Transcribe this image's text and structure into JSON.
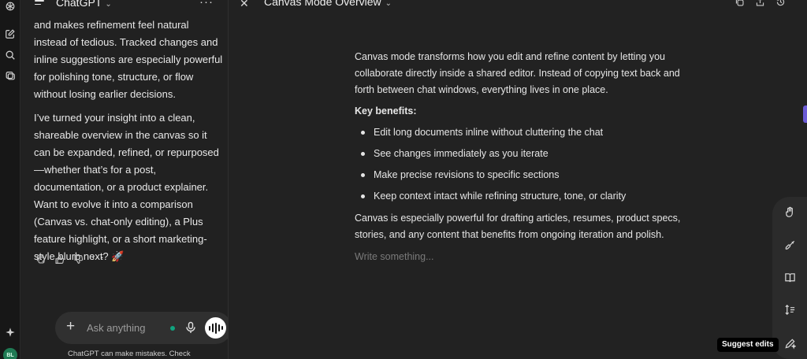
{
  "app": {
    "title": "ChatGPT",
    "avatar_initials": "BL"
  },
  "chat": {
    "message_1": "and makes refinement feel natural instead of tedious. Tracked changes and inline suggestions are especially powerful for polishing tone, structure, or flow without losing earlier decisions.",
    "message_2": "I’ve turned your insight into a clean, shareable overview in the canvas so it can be expanded, refined, or repurposed—whether that’s for a post, documentation, or a product explainer. Want to evolve it into a comparison (Canvas vs. chat-only editing), a Plus feature highlight, or a short marketing-style blurb next? 🚀",
    "composer_placeholder": "Ask anything",
    "disclaimer": "ChatGPT can make mistakes. Check"
  },
  "canvas": {
    "title": "Canvas Mode Overview",
    "intro": "Canvas mode transforms how you edit and refine content by letting you collaborate directly inside a shared editor. Instead of copying text back and forth between chat windows, everything lives in one place.",
    "benefits_heading": "Key benefits:",
    "benefits": [
      "Edit long documents inline without cluttering the chat",
      "See changes immediately as you iterate",
      "Make precise revisions to specific sections",
      "Keep context intact while refining structure, tone, or clarity"
    ],
    "outro": "Canvas is especially powerful for drafting articles, resumes, product specs, stories, and any content that benefits from ongoing iteration and polish.",
    "write_placeholder": "Write something...",
    "tooltip": "Suggest edits"
  },
  "colors": {
    "accent": "#10a37f",
    "edge_tab": "#6b5bd6",
    "background": "#212121"
  }
}
